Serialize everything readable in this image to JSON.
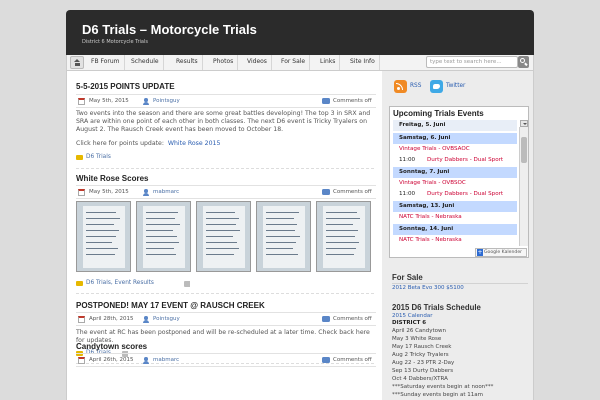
{
  "site": {
    "title": "D6 Trials – Motorcycle Trials",
    "description": "District 6 Motorcycle Trials"
  },
  "nav": {
    "items": [
      "FB Forum",
      "Schedule",
      "Results",
      "Photos",
      "Videos",
      "For Sale",
      "Links",
      "Site Info"
    ],
    "search_placeholder": "type text to search here..."
  },
  "posts": [
    {
      "title": "5-5-2015 POINTS UPDATE",
      "date": "May 5th, 2015",
      "author": "Pointsguy",
      "comments": "Comments off",
      "body": "Two events into the season and there are some great battles developing! The top 3 in SRX and SRA are within one point of each other in both classes. The next D6 event is Tricky Tryalers on August 2. The Rausch Creek event has been moved to October 18.",
      "link_prefix": "Click here for points update:",
      "link_text": "White Rose 2015",
      "categories": "D6 Trials"
    },
    {
      "title": "White Rose Scores",
      "date": "May 5th, 2015",
      "author": "mabmarc",
      "comments": "Comments off",
      "categories": "D6 Trials, Event Results"
    },
    {
      "title": "POSTPONED! MAY 17 EVENT @ RAUSCH CREEK",
      "date": "April 28th, 2015",
      "author": "Pointsguy",
      "comments": "Comments off",
      "body": "The event at RC has been postponed and will be re-scheduled at a later time. Check back here for updates.",
      "categories": "D6 Trials"
    },
    {
      "title": "Candytown scores",
      "date": "April 26th, 2015",
      "author": "mabmarc",
      "comments": "Comments off"
    }
  ],
  "sidebar": {
    "rss": "RSS",
    "twitter": "Twitter",
    "calendar": {
      "title": "Upcoming Trials Events",
      "current": "Freitag, 5. Juni",
      "rows": [
        {
          "kind": "day",
          "text": "Samstag, 6. Juni"
        },
        {
          "kind": "event",
          "name": "Vintage Trials - OVBSAOC"
        },
        {
          "kind": "event",
          "time": "11:00",
          "name": "Durty Dabbers - Dual Sport"
        },
        {
          "kind": "day",
          "text": "Sonntag, 7. Juni"
        },
        {
          "kind": "event",
          "name": "Vintage Trials - OVBSOC"
        },
        {
          "kind": "event",
          "time": "11:00",
          "name": "Durty Dabbers - Dual Sport"
        },
        {
          "kind": "day",
          "text": "Samstag, 13. Juni"
        },
        {
          "kind": "event",
          "name": "NATC Trials - Nebraska"
        },
        {
          "kind": "day",
          "text": "Sonntag, 14. Juni"
        },
        {
          "kind": "event",
          "name": "NATC Trials - Nebraska"
        }
      ],
      "google_label": "Google Kalender"
    },
    "for_sale": {
      "heading": "For Sale",
      "item": "2012 Beta Evo 300 $5100"
    },
    "schedule": {
      "heading": "2015 D6 Trials Schedule",
      "link": "2015 Calendar",
      "district": "DISTRICT 6",
      "lines": [
        "April 26 Candytown",
        "May 3 White Rose",
        "May 17 Rausch Creek",
        "Aug 2 Tricky Tryalers",
        "Aug 22 - 23 PTR 2-Day",
        "Sep 13 Durty Dabbers",
        "Oct 4 Dabbers/XTRA",
        "***Saturday events begin at noon***",
        "***Sunday events begin at 11am"
      ]
    }
  }
}
